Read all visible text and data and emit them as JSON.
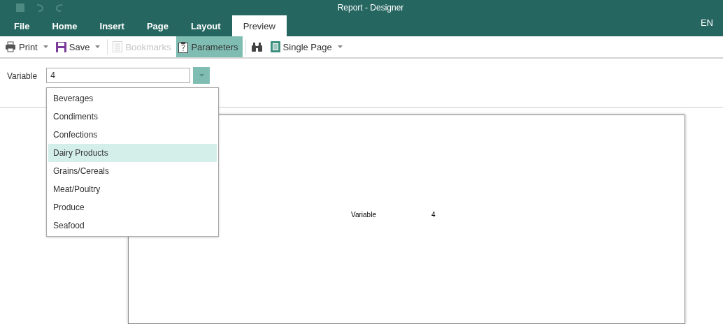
{
  "window": {
    "title": "Report - Designer"
  },
  "tabs": [
    {
      "label": "File",
      "selected": false
    },
    {
      "label": "Home",
      "selected": false
    },
    {
      "label": "Insert",
      "selected": false
    },
    {
      "label": "Page",
      "selected": false
    },
    {
      "label": "Layout",
      "selected": false
    },
    {
      "label": "Preview",
      "selected": true
    }
  ],
  "language": "EN",
  "toolbar": [
    {
      "kind": "print",
      "label": "Print",
      "dropdown": true,
      "disabled": false,
      "selected": false
    },
    {
      "kind": "save",
      "label": "Save",
      "dropdown": true,
      "disabled": false,
      "selected": false
    },
    {
      "kind": "bookmarks",
      "label": "Bookmarks",
      "dropdown": false,
      "disabled": true,
      "selected": false
    },
    {
      "kind": "parameters",
      "label": "Parameters",
      "dropdown": false,
      "disabled": false,
      "selected": true
    },
    {
      "kind": "find",
      "dropdown": false,
      "disabled": false,
      "selected": false
    },
    {
      "kind": "page",
      "label": "Single Page",
      "dropdown": true,
      "disabled": false,
      "selected": false
    }
  ],
  "parameter": {
    "label": "Variable",
    "value": "4",
    "expanded": true,
    "options": [
      {
        "label": "Beverages",
        "selected": false
      },
      {
        "label": "Condiments",
        "selected": false
      },
      {
        "label": "Confections",
        "selected": false
      },
      {
        "label": "Dairy Products",
        "selected": true
      },
      {
        "label": "Grains/Cereals",
        "selected": false
      },
      {
        "label": "Meat/Poultry",
        "selected": false
      },
      {
        "label": "Produce",
        "selected": false
      },
      {
        "label": "Seafood",
        "selected": false
      }
    ]
  },
  "report_page": {
    "label": "Variable",
    "value": "4"
  }
}
